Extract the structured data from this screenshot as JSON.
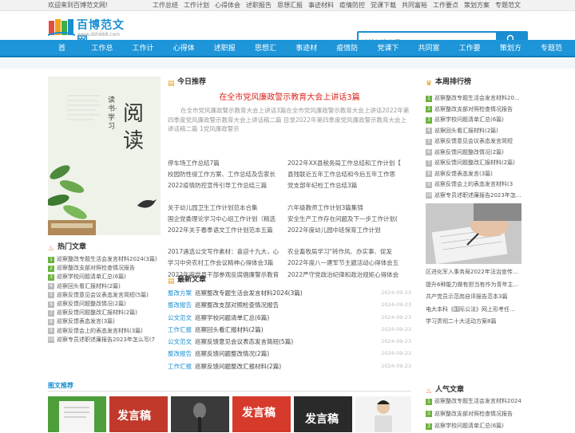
{
  "topbar": {
    "welcome": "欢迎来到百博范文网!",
    "links": [
      "工作总结",
      "工作计划",
      "心得体会",
      "述职报告",
      "思想汇报",
      "事迹材料",
      "疫情防控",
      "党课下载",
      "共同富裕",
      "工作要点",
      "策划方案",
      "专题范文"
    ]
  },
  "logo": {
    "name": "百博范文网",
    "url": "www.dzh668.com"
  },
  "search": {
    "placeholder": "请输入搜索词"
  },
  "nav": [
    "首 页",
    "工作总结",
    "工作计划",
    "心得体会",
    "述职报告",
    "思想汇报",
    "事迹材料",
    "疫情防控",
    "党课下载",
    "共同富裕",
    "工作要点",
    "策划方案",
    "专题范文"
  ],
  "book_image": {
    "vertical_text": "读书·学习",
    "big_text": "阅读"
  },
  "hot": {
    "title": "热门文章",
    "items": [
      "巡察整改专题生活会发言材料2024(3篇)",
      "巡察整改支部对照检查情况报告",
      "巡察学校问题清单汇总(6篇)",
      "巡察回头看汇报材料(2篇)",
      "巡察反馈意见会议表态发言简短(5篇)",
      "巡察反馈问题整改情况(2篇)",
      "巡察反馈问题整改汇报材料(2篇)",
      "巡察反馈表态发言(3篇)",
      "巡察反馈会上的表态发言材料(3篇)",
      "巡察专员述职述廉报告2023年怎么写(7"
    ]
  },
  "today": {
    "title": "今日推荐",
    "headline": "在全市党风廉政警示教育大会上讲话3篇",
    "summary": "在全市党风廉政警示教育大会上讲话3篇在全市党风廉政警示教育大会上讲话2022年第四季度党风廉政警示教育大会上讲话稿二篇    目录2022年第四季度党风廉政警示教育大会上讲话稿二篇 1党风廉政警示",
    "col_a": [
      [
        "停车场工作总结7篇",
        "校园防性侵工作方案、工作总结及告家长",
        "2022疫情防控宣传引导工作总结三篇"
      ],
      [
        "关于幼儿园卫生工作计划范本合集",
        "国企党委理论学习中心组工作计划（精选",
        "2022年关于春季语文工作计划范本五篇"
      ],
      [
        "2017遇选公文写作素材：喜迎十九大，心",
        "学习中央农村工作会议精神心得体会3篇",
        "2022年度党员干部参观反腐倡廉警示教育"
      ]
    ],
    "col_b": [
      [
        "2022年XX县税务局工作总结和工作计划【",
        "县残联近五年工作总结和今后五年工作思",
        "党支部年纪检工作总结3篇"
      ],
      [
        "六年级教师工作计划3篇集锦",
        "安全生产工作存在问题及下一步工作计划(",
        "2022年度幼儿园中班保育工作计划"
      ],
      [
        "农业畜牧局学习\"转作风、办实事、促发",
        "2022年度八一建军节主题活动心得体会五",
        "2022严守党政治纪律和政治规矩心得体会"
      ]
    ]
  },
  "latest": {
    "title": "最新文章",
    "items": [
      {
        "cat": "整改方案",
        "title": "巡察整改专题生活会发言材料2024(3篇)",
        "date": "2024-09-23"
      },
      {
        "cat": "整改报告",
        "title": "巡察整改支部对照检查情况报告",
        "date": "2024-09-23"
      },
      {
        "cat": "公文范文",
        "title": "巡察学校问题清单汇总(6篇)",
        "date": "2024-09-23"
      },
      {
        "cat": "工作汇报",
        "title": "巡察回头看汇报材料(2篇)",
        "date": "2024-09-23"
      },
      {
        "cat": "公文范文",
        "title": "巡察反馈意见会议表态发言简短(5篇)",
        "date": "2024-09-23"
      },
      {
        "cat": "整改报告",
        "title": "巡察反馈问题整改情况(2篇)",
        "date": "2024-09-23"
      },
      {
        "cat": "工作汇报",
        "title": "巡察反馈问题整改汇报材料(2篇)",
        "date": "2024-09-23"
      }
    ]
  },
  "rank": {
    "title": "本周排行榜",
    "items": [
      "巡察整改专题生活会发言材料20...",
      "巡察整改支部对照检查情况报告",
      "巡察学校问题清单汇总(6篇)",
      "巡察回头看汇报材料(2篇)",
      "巡察反馈意见会议表态发言简短",
      "巡察反馈问题整改情况(2篇)",
      "巡察反馈问题整改汇报材料(2篇)",
      "巡察反馈表态发言(3篇)",
      "巡察反馈会上的表态发言材料(3",
      "巡察专员述职述廉报告2023年怎..."
    ],
    "links": [
      "区进化军入事务局2022年法治宣传...",
      "提升6种能力做有担当有作为青年主...",
      "共产党员示范岗自评报告范本3篇",
      "电大本科《国际公法》网上形考任...",
      "学习贯彻二十大活动方案8篇"
    ]
  },
  "pics": {
    "title": "图文推荐",
    "labels": [
      "发言稿",
      "发言稿",
      "发言稿"
    ]
  },
  "popular": {
    "title": "人气文章",
    "items": [
      "巡察整改专题生活会发言材料2024(3",
      "巡察整改支部对照检查情况报告",
      "巡察学校问题清单汇总(6篇)"
    ]
  },
  "colors": {
    "accent": "#1d95d8",
    "headline_red": "#d8261c",
    "rank_green": "#6cb33f"
  }
}
